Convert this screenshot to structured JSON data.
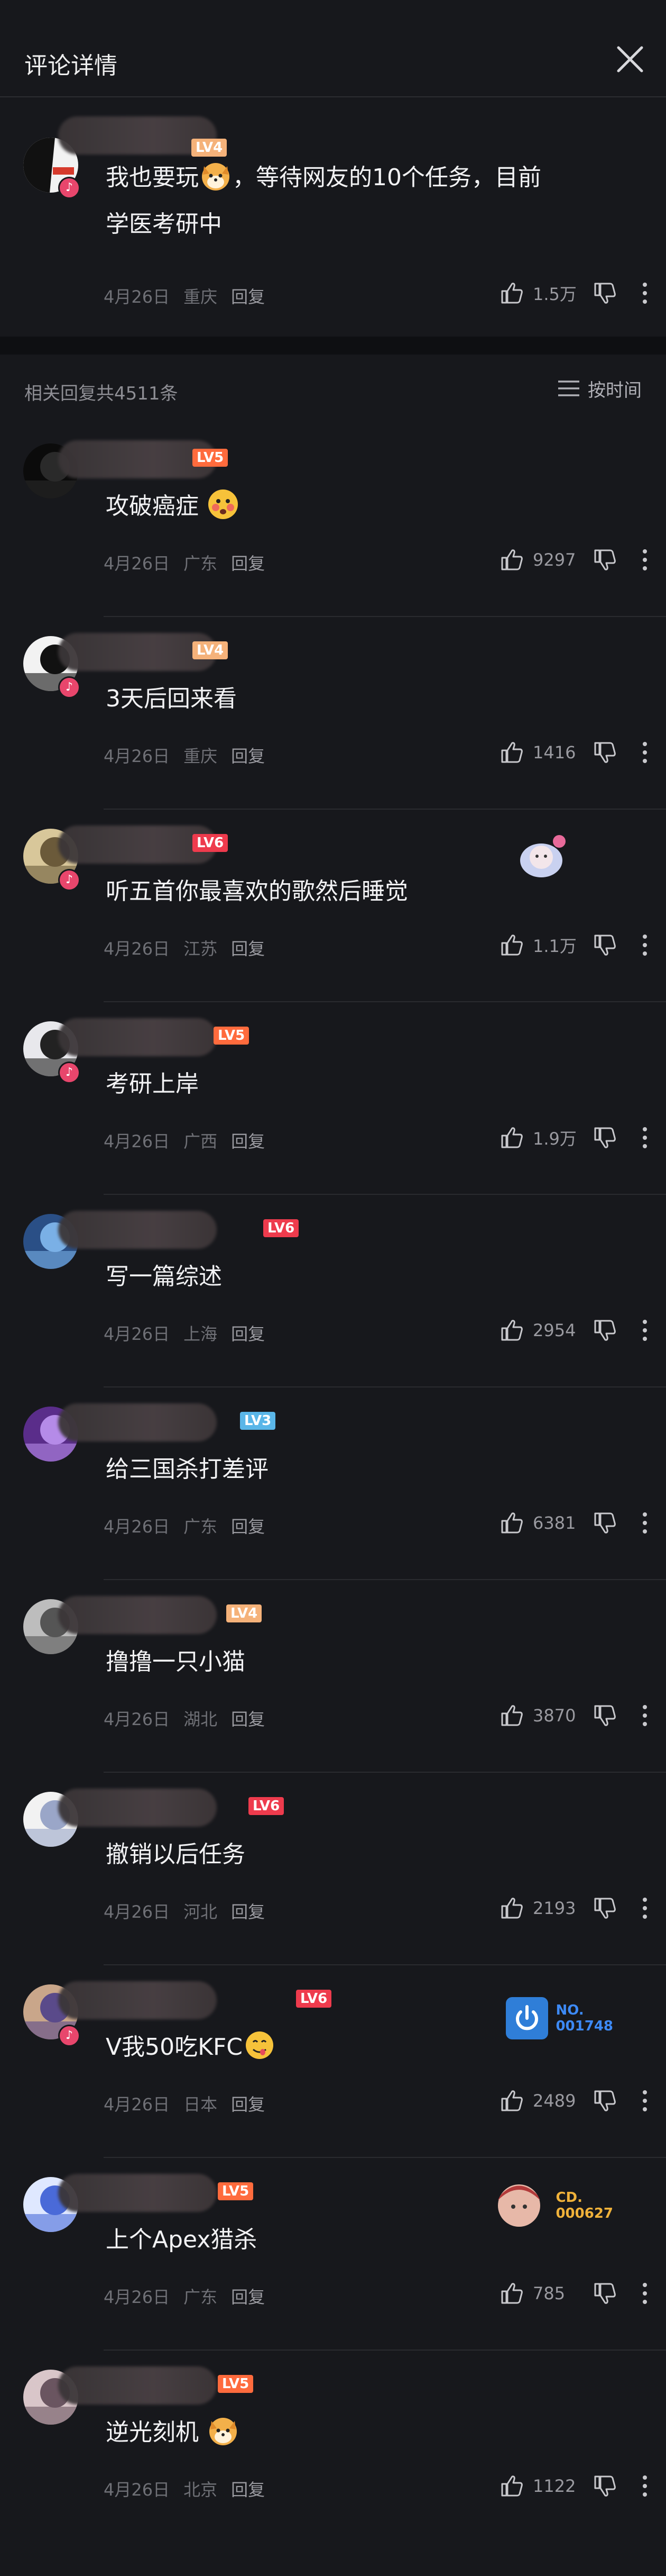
{
  "header": {
    "title": "评论详情"
  },
  "main_comment": {
    "level": "LV4",
    "text_line1": "我也要玩",
    "text_line1_after": "，等待网友的10个任务，目前",
    "text_line2": "学医考研中",
    "date": "4月26日",
    "location": "重庆",
    "reply_label": "回复",
    "likes": "1.5万"
  },
  "replies_header": {
    "count_text": "相关回复共4511条",
    "sort_label": "按时间"
  },
  "comments": [
    {
      "level": "LV5",
      "text": "攻破癌症",
      "emoji": "flushed-face",
      "date": "4月26日",
      "location": "广东",
      "reply": "回复",
      "likes": "9297"
    },
    {
      "level": "LV4",
      "text": "3天后回来看",
      "date": "4月26日",
      "location": "重庆",
      "reply": "回复",
      "likes": "1416"
    },
    {
      "level": "LV6",
      "text": "听五首你最喜欢的歌然后睡觉",
      "date": "4月26日",
      "location": "江苏",
      "reply": "回复",
      "likes": "1.1万"
    },
    {
      "level": "LV5",
      "text": "考研上岸",
      "date": "4月26日",
      "location": "广西",
      "reply": "回复",
      "likes": "1.9万"
    },
    {
      "level": "LV6",
      "text": "写一篇综述",
      "date": "4月26日",
      "location": "上海",
      "reply": "回复",
      "likes": "2954"
    },
    {
      "level": "LV3",
      "text": "给三国杀打差评",
      "date": "4月26日",
      "location": "广东",
      "reply": "回复",
      "likes": "6381"
    },
    {
      "level": "LV4",
      "text": "撸撸一只小猫",
      "date": "4月26日",
      "location": "湖北",
      "reply": "回复",
      "likes": "3870"
    },
    {
      "level": "LV6",
      "text": "撤销以后任务",
      "date": "4月26日",
      "location": "河北",
      "reply": "回复",
      "likes": "2193"
    },
    {
      "level": "LV6",
      "text": "V我50吃KFC",
      "date": "4月26日",
      "location": "日本",
      "reply": "回复",
      "likes": "2489",
      "badge_no": "NO.\n001748"
    },
    {
      "level": "LV5",
      "text": "上个Apex猎杀",
      "date": "4月26日",
      "location": "广东",
      "reply": "回复",
      "likes": "785",
      "badge_no": "CD.\n000627"
    },
    {
      "level": "LV5",
      "text": "逆光刻机",
      "date": "4月26日",
      "location": "北京",
      "reply": "回复",
      "likes": "1122"
    }
  ],
  "colors": {
    "background": "#17181c",
    "accent_pink": "#e8466c",
    "text_muted": "#6f7076"
  }
}
